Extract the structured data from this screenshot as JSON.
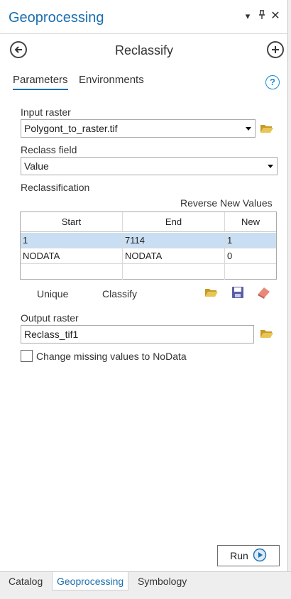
{
  "pane": {
    "title": "Geoprocessing"
  },
  "titlebar_icons": {
    "menu": "dropdown-icon",
    "pin": "pin-icon",
    "close": "close-icon"
  },
  "tool": {
    "title": "Reclassify",
    "back_icon": "back-arrow-icon",
    "add_icon": "add-icon"
  },
  "tabs": [
    {
      "label": "Parameters",
      "active": true
    },
    {
      "label": "Environments",
      "active": false
    }
  ],
  "help_label": "?",
  "input_raster": {
    "label": "Input raster",
    "value": "Polygont_to_raster.tif"
  },
  "reclass_field": {
    "label": "Reclass field",
    "value": "Value"
  },
  "reclassification": {
    "label": "Reclassification",
    "reverse_label": "Reverse New Values",
    "columns": [
      "Start",
      "End",
      "New"
    ],
    "rows": [
      {
        "start": "1",
        "end": "7114",
        "new": "1"
      },
      {
        "start": "NODATA",
        "end": "NODATA",
        "new": "0"
      }
    ]
  },
  "actions": {
    "unique": "Unique",
    "classify": "Classify"
  },
  "output_raster": {
    "label": "Output raster",
    "value": "Reclass_tif1"
  },
  "checkbox": {
    "label": "Change missing values to NoData",
    "checked": false
  },
  "run": {
    "label": "Run"
  },
  "bottom_tabs": [
    {
      "label": "Catalog",
      "active": false
    },
    {
      "label": "Geoprocessing",
      "active": true
    },
    {
      "label": "Symbology",
      "active": false
    }
  ],
  "colors": {
    "accent": "#1a6eb0",
    "selection": "#c9def2",
    "folder": "#d9b43c"
  }
}
